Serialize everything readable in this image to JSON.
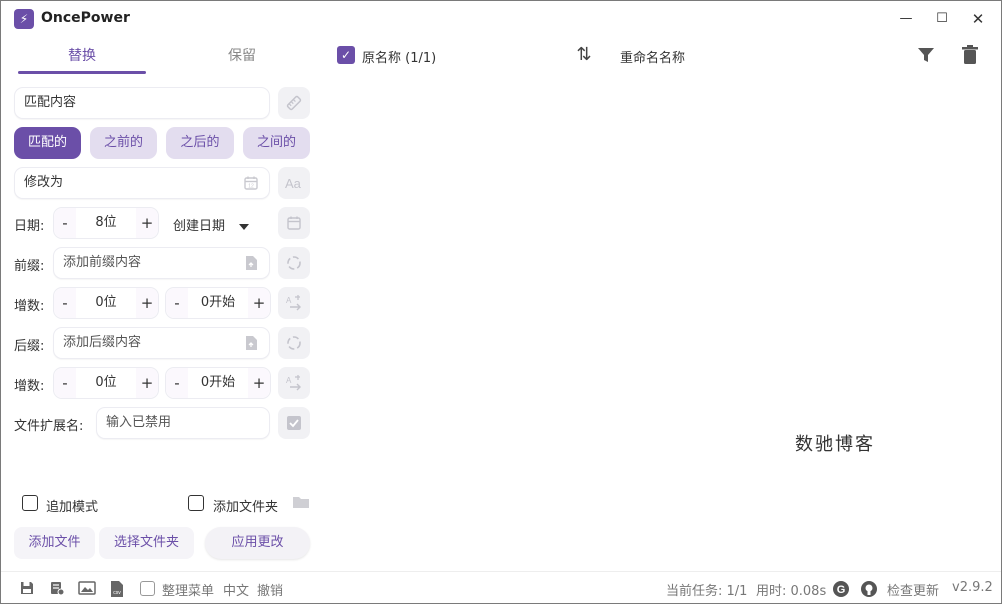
{
  "app": {
    "title": "OncePower",
    "logo_glyph": "⚡",
    "version": "v2.9.2"
  },
  "window": {
    "minimize": "—",
    "maximize": "☐",
    "close": "✕"
  },
  "tabs": {
    "replace": "替换",
    "keep": "保留"
  },
  "match": {
    "value": "匹配内容"
  },
  "modes": [
    "匹配的",
    "之前的",
    "之后的",
    "之间的"
  ],
  "replace_with": {
    "value": "修改为"
  },
  "date": {
    "label": "日期:",
    "digits": "8位",
    "minus": "-",
    "plus": "+",
    "type": "创建日期"
  },
  "prefix": {
    "label": "前缀:",
    "placeholder": "添加前缀内容"
  },
  "inc1": {
    "label": "增数:",
    "digits": "0位",
    "start": "0开始",
    "minus": "-",
    "plus": "+"
  },
  "suffix": {
    "label": "后缀:",
    "placeholder": "添加后缀内容"
  },
  "inc2": {
    "label": "增数:",
    "digits": "0位",
    "start": "0开始",
    "minus": "-",
    "plus": "+"
  },
  "extension": {
    "label": "文件扩展名:",
    "placeholder": "输入已禁用"
  },
  "options": {
    "append_mode": "追加模式",
    "add_folder": "添加文件夹"
  },
  "buttons": {
    "add_files": "添加文件",
    "select_folder": "选择文件夹",
    "apply": "应用更改"
  },
  "list_header": {
    "original": "原名称 (1/1)",
    "renamed": "重命名名称",
    "check_glyph": "✓",
    "sort_glyph": "⇅"
  },
  "watermark": "数驰博客",
  "status": {
    "organize_menu": "整理菜单",
    "language": "中文",
    "undo": "撤销",
    "current_task": "当前任务: 1/1",
    "elapsed": "用时: 0.08s",
    "check_update": "检查更新"
  },
  "colors": {
    "accent": "#6b4fa8",
    "mode_bg": "#e3ddef"
  }
}
